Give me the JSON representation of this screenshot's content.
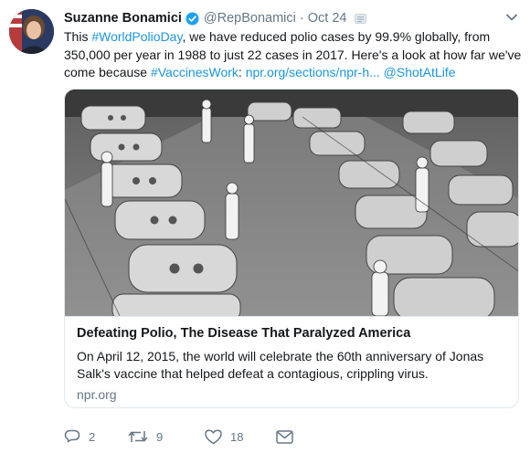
{
  "author": {
    "display_name": "Suzanne Bonamici",
    "handle": "@RepBonamici",
    "separator": "·",
    "date": "Oct 24",
    "verified_icon": "verified-badge-icon",
    "avatar_icon": "profile-photo"
  },
  "tweet": {
    "text_parts": {
      "p1": "This ",
      "hashtag1": "#WorldPolioDay",
      "p2": ", we have reduced polio cases by 99.9% globally, from",
      "line2": "350,000 per year in 1988 to just 22 cases in 2017. Here's a look at how far we've",
      "p3": "come because ",
      "hashtag2": "#VaccinesWork",
      "p4": ": ",
      "link": "npr.org/sections/npr-h...",
      "p5": " ",
      "mention": "@ShotAtLife"
    }
  },
  "card": {
    "title": "Defeating Polio, The Disease That Paralyzed America",
    "description_lines": [
      "On April 12, 2015, the world will celebrate the 60th anniversary of Jonas",
      "Salk's vaccine that helped defeat a contagious, crippling virus."
    ],
    "domain": "npr.org",
    "image_icon": "iron-lung-ward-photo"
  },
  "actions": {
    "reply_count": "2",
    "retweet_count": "9",
    "like_count": "18"
  },
  "colors": {
    "link": "#1b95e0",
    "secondary_text": "#657786",
    "border": "#e1e8ed",
    "verified": "#1da1f2"
  }
}
